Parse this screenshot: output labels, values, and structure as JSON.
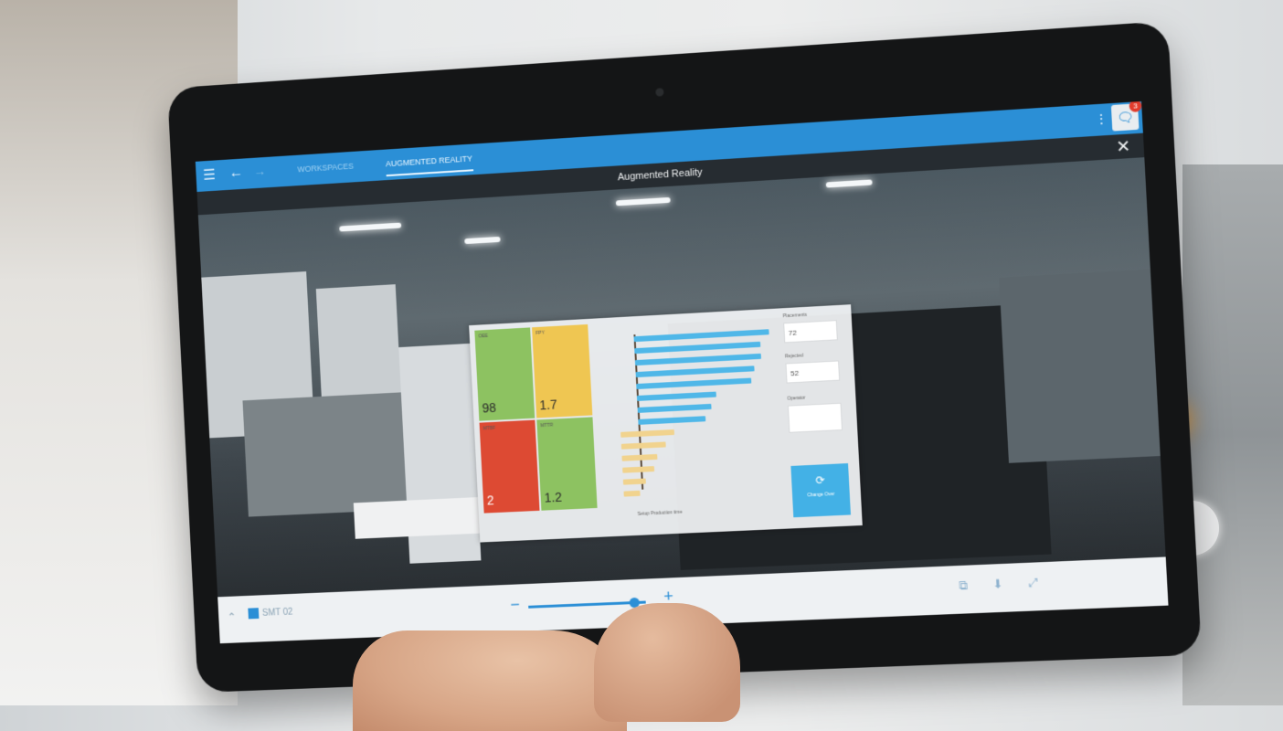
{
  "app": {
    "tabs": [
      "WORKSPACES",
      "AUGMENTED REALITY"
    ],
    "active_tab": "AUGMENTED REALITY",
    "notification_count": "3"
  },
  "header": {
    "title": "Augmented Reality"
  },
  "ar_panel": {
    "tiles": [
      {
        "label": "OEE",
        "value": "98",
        "color": "#8dc261"
      },
      {
        "label": "FPY",
        "value": "1.7",
        "color": "#efc652"
      },
      {
        "label": "MTBF",
        "value": "2",
        "color": "#dd4a33"
      },
      {
        "label": "MTTR",
        "value": "1.2",
        "color": "#8dc261"
      }
    ],
    "chart_caption": "Setup     Production time",
    "sidebar": {
      "box1_label": "Placements",
      "box1_value": "72",
      "box2_label": "Rejected",
      "box2_value": "52",
      "box3_label": "Operator",
      "sync_label": "Change Over"
    }
  },
  "chart_data": {
    "type": "bar",
    "orientation": "horizontal",
    "series": [
      {
        "color": "#4fb7e8",
        "values": [
          150,
          140,
          140,
          132,
          128,
          88,
          82,
          75
        ]
      },
      {
        "color": "#f1d38e",
        "values": [
          60,
          50,
          40,
          35,
          25,
          18
        ]
      }
    ]
  },
  "toolbar": {
    "machine": "SMT 02",
    "zoom_level": 0.9
  },
  "icons": {
    "menu": "menu-icon",
    "back": "arrow-left-icon",
    "forward": "arrow-right-icon",
    "more": "more-vertical-icon",
    "notifications": "chat-icon",
    "close": "close-icon",
    "sync": "refresh-icon"
  }
}
